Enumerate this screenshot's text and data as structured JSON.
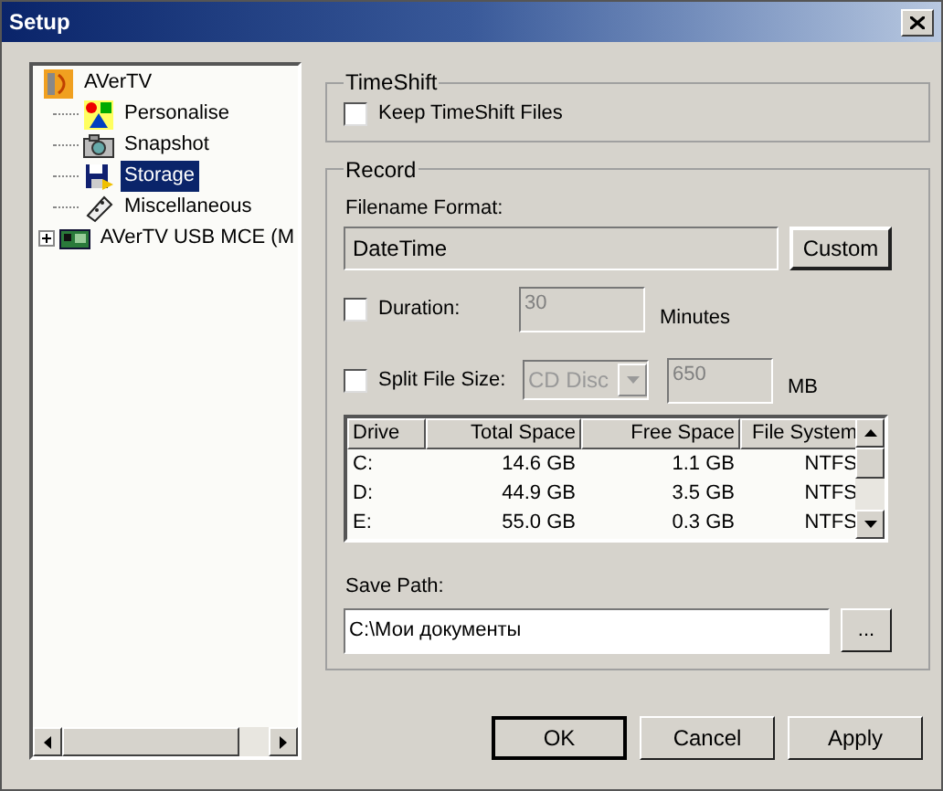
{
  "window": {
    "title": "Setup"
  },
  "tree": [
    {
      "label": "AVerTV",
      "selected": false,
      "children": [
        {
          "label": "Personalise",
          "selected": false
        },
        {
          "label": "Snapshot",
          "selected": false
        },
        {
          "label": "Storage",
          "selected": true
        },
        {
          "label": "Miscellaneous",
          "selected": false
        }
      ]
    },
    {
      "label": "AVerTV USB MCE (M",
      "selected": false,
      "expanded": false
    }
  ],
  "timeshift": {
    "title": "TimeShift",
    "keep_files": {
      "label": "Keep TimeShift Files",
      "checked": false
    }
  },
  "record": {
    "title": "Record",
    "filename_format": {
      "label": "Filename Format:",
      "value": "DateTime",
      "button": "Custom"
    },
    "duration": {
      "label": "Duration:",
      "checked": false,
      "value": "30",
      "disabled": true,
      "unit": "Minutes"
    },
    "split": {
      "label": "Split File Size:",
      "checked": false,
      "dropdown": "CD Disc",
      "value": "650",
      "disabled": true,
      "unit": "MB"
    },
    "drives": {
      "columns": [
        "Drive",
        "Total Space",
        "Free Space",
        "File System"
      ],
      "rows": [
        [
          "C:",
          "14.6 GB",
          "1.1 GB",
          "NTFS"
        ],
        [
          "D:",
          "44.9 GB",
          "3.5 GB",
          "NTFS"
        ],
        [
          "E:",
          "55.0 GB",
          "0.3 GB",
          "NTFS"
        ]
      ]
    },
    "save_path": {
      "label": "Save Path:",
      "value": "C:\\Мои документы",
      "button": "..."
    }
  },
  "buttons": [
    {
      "label": "OK",
      "default": true
    },
    {
      "label": "Cancel",
      "default": false
    },
    {
      "label": "Apply",
      "default": false
    }
  ]
}
